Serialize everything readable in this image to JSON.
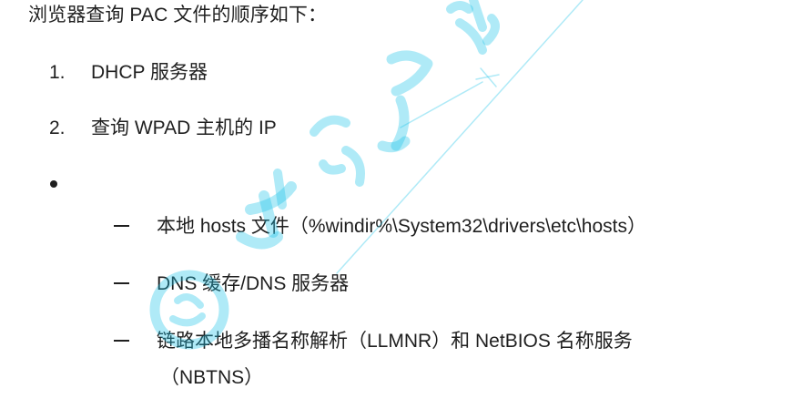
{
  "intro": "浏览器查询 PAC 文件的顺序如下：",
  "ordered": [
    {
      "num": "1.",
      "text": "DHCP 服务器"
    },
    {
      "num": "2.",
      "text": "查询 WPAD 主机的 IP"
    }
  ],
  "sub_items": [
    "本地 hosts 文件（%windir%\\System32\\drivers\\etc\\hosts）",
    "DNS 缓存/DNS 服务器",
    "链路本地多播名称解析（LLMNR）和 NetBIOS 名称服务",
    "（NBTNS）"
  ],
  "watermark": {
    "color": "#19c4e8",
    "icon": "logo-watermark"
  }
}
